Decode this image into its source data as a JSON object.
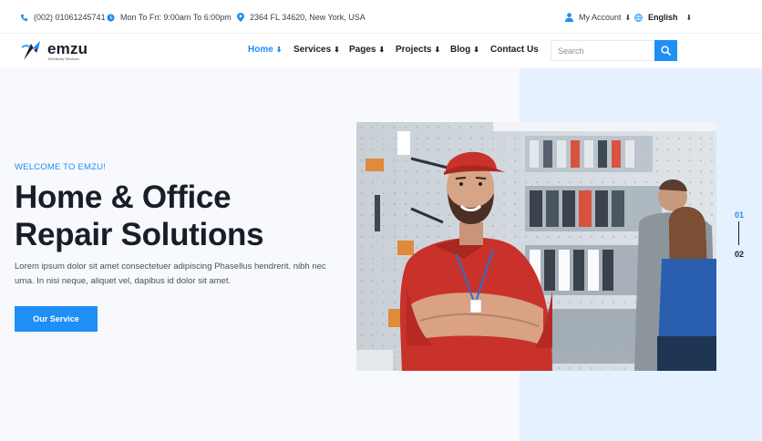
{
  "topbar": {
    "phone": "(002) 01061245741",
    "hours": "Mon To Fri: 9:00am To 6:00pm",
    "address": "2364 FL 34620, New York, USA",
    "account": "My Account",
    "language": "English"
  },
  "brand": {
    "name": "emzu",
    "tagline": "Electricity Services"
  },
  "nav": {
    "items": [
      {
        "label": "Home",
        "arrow": "⬇"
      },
      {
        "label": "Services",
        "arrow": "⬇"
      },
      {
        "label": "Pages",
        "arrow": "⬇"
      },
      {
        "label": "Projects",
        "arrow": "⬇"
      },
      {
        "label": "Blog",
        "arrow": "⬇"
      },
      {
        "label": "Contact Us",
        "arrow": ""
      }
    ]
  },
  "search": {
    "placeholder": "Search",
    "value": ""
  },
  "hero": {
    "eyebrow": "WELCOME TO EMZU!",
    "headline_line1": "Home & Office",
    "headline_line2": "Repair Solutions",
    "description": "Lorem ipsum dolor sit amet consectetuer adipiscing Phasellus hendrerit. nibh nec urna. In nisi neque, aliquet vel, dapibus id dolor sit amet.",
    "cta_label": "Our Service"
  },
  "slider": {
    "current": "01",
    "next": "02"
  },
  "colors": {
    "accent": "#1e8ff5",
    "text": "#1a1d29",
    "panel": "#e5f1fe"
  }
}
